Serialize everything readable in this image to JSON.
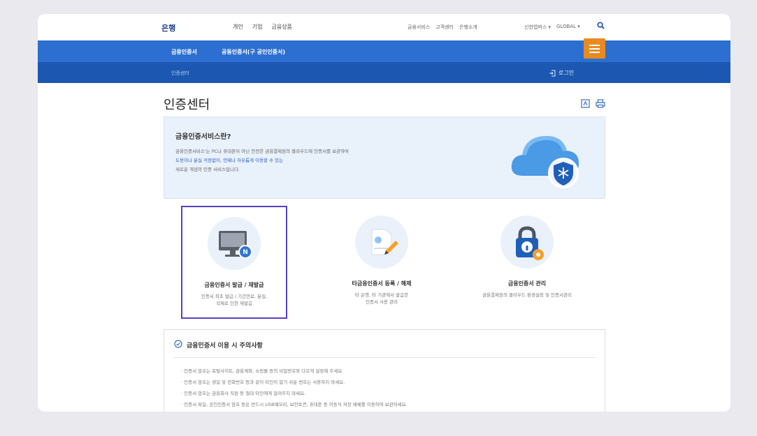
{
  "brand": "은행",
  "main_menu": [
    "개인",
    "기업",
    "금융상품"
  ],
  "util_menu": [
    "금융서비스",
    "고객센터",
    "은행소개"
  ],
  "lang_menu": [
    "신한앱버스 ▾",
    "GLOBAL ▾"
  ],
  "nav": {
    "tab1": "금융인증서",
    "tab2": "공동인증서(구 공인인증서)",
    "breadcrumb": "인증센터",
    "login": "로그인"
  },
  "page_title": "인증센터",
  "intro": {
    "heading": "금융인증서비스란?",
    "line1": "금융인증서비스'는 PC나 휴대폰이 아닌 안전한 금융결제원의 클라우드에 인증서를 보관하여",
    "line2": "도용이나 분실 걱정없이, 언제나 자유롭게 이용할 수 있는",
    "line3": "새로운 개념의 인증 서비스입니다."
  },
  "cards": [
    {
      "title": "금융인증서 발급 / 재발급",
      "desc1": "인증서 최초 발급 / 기간만료, 분실,",
      "desc2": "삭제로 인한 재발급",
      "icon": "monitor-icon"
    },
    {
      "title": "타금융인증서 등록 / 해제",
      "desc1": "타 은행, 타 기관에서 발급한",
      "desc2": "인증서 사용 관리",
      "icon": "document-pen-icon"
    },
    {
      "title": "금융인증서 관리",
      "desc1": "금융결제원의 클라우드 환경설정 및 인증서관리",
      "desc2": "",
      "icon": "lock-gear-icon"
    }
  ],
  "notice": {
    "heading": "금융인증서 이용 시 주의사항",
    "items": [
      "· 인증서 암호는 포털사이트, 금융계좌, 쇼핑몰 등의 비밀번호와 다르게 설정해 주세요.",
      "· 인증서 암호는 생일 및 전화번호 등과 같이 타인이 알기 쉬운 번호는 사용하지 마세요.",
      "· 인증서 암호는 금융회사 직원 등 절대 타인에게 알려주지 마세요.",
      "· 인증서 파일, 공인인증서 암호 등은 반드시 USB메모리, 보안토큰, 휴대폰 등 이동식 저장 매체를 이용하여 보관하세요."
    ]
  },
  "colors": {
    "primary_blue": "#2c6fd0",
    "dark_blue": "#1c57b1",
    "menu_orange": "#e98a20",
    "selection_purple": "#5a3fc3"
  }
}
